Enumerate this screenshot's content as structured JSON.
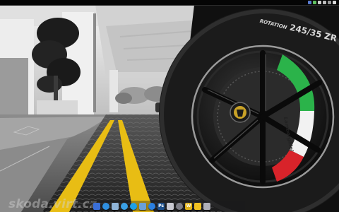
{
  "watermark": {
    "text": "skoda.virt.cz"
  },
  "tire": {
    "sidewall_text": "245/35 ZR",
    "rotation_text": "ROTATION"
  },
  "caliper": {
    "text": "Lamborghini"
  },
  "dock": {
    "items": [
      {
        "name": "finder-icon",
        "color": "#3a6fd8",
        "shape": "square",
        "label": ""
      },
      {
        "name": "safari-icon",
        "color": "#2f8fe0",
        "shape": "round",
        "label": ""
      },
      {
        "name": "mail-icon",
        "color": "#8fb4d8",
        "shape": "square",
        "label": ""
      },
      {
        "name": "itunes-icon",
        "color": "#3aa0e6",
        "shape": "round",
        "label": ""
      },
      {
        "name": "skype-icon",
        "color": "#1ea0e8",
        "shape": "round",
        "label": ""
      },
      {
        "name": "facetime-icon",
        "color": "#6aa0d8",
        "shape": "square",
        "label": ""
      },
      {
        "name": "app-store-icon",
        "color": "#2a7fe0",
        "shape": "round",
        "label": ""
      },
      {
        "name": "photoshop-icon",
        "color": "#1d4f8a",
        "shape": "square",
        "label": "Ps"
      },
      {
        "name": "preview-icon",
        "color": "#c8c8d0",
        "shape": "square",
        "label": ""
      },
      {
        "name": "system-preferences-icon",
        "color": "#7d7d86",
        "shape": "round",
        "label": ""
      },
      {
        "name": "word-icon",
        "color": "#e0b21a",
        "shape": "square",
        "label": "W"
      },
      {
        "name": "keys-icon",
        "color": "#f0c020",
        "shape": "square",
        "label": ""
      },
      {
        "name": "trash-icon",
        "color": "#b0b0b8",
        "shape": "square",
        "label": ""
      }
    ]
  },
  "tray": {
    "items": [
      {
        "name": "menu-extra-icon",
        "color": "#5a7bd0"
      },
      {
        "name": "status-icon",
        "color": "#60c060"
      },
      {
        "name": "volume-icon",
        "color": "#cfcfcf"
      },
      {
        "name": "wifi-icon",
        "color": "#bfbfbf"
      },
      {
        "name": "clock-icon",
        "color": "#9a9a9a"
      },
      {
        "name": "spotlight-icon",
        "color": "#d8d8d8"
      }
    ]
  },
  "colors": {
    "road_line": "#e8bd14",
    "caliper_green": "#2bb34a",
    "caliper_red": "#d8232a",
    "caliper_white": "#f2f2f2"
  }
}
